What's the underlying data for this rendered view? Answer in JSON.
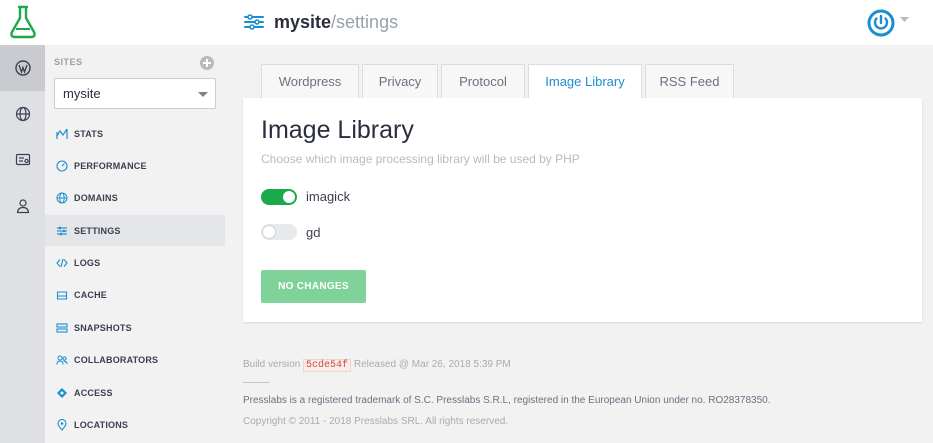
{
  "header": {
    "site_name": "mysite",
    "path": "/settings"
  },
  "sidebar": {
    "sites_label": "SITES",
    "selected_site": "mysite",
    "items": [
      {
        "label": "STATS",
        "icon": "stats-icon"
      },
      {
        "label": "PERFORMANCE",
        "icon": "gauge-icon"
      },
      {
        "label": "DOMAINS",
        "icon": "globe-icon"
      },
      {
        "label": "SETTINGS",
        "icon": "sliders-icon",
        "active": true
      },
      {
        "label": "LOGS",
        "icon": "code-icon"
      },
      {
        "label": "CACHE",
        "icon": "cache-icon"
      },
      {
        "label": "SNAPSHOTS",
        "icon": "snapshots-icon"
      },
      {
        "label": "COLLABORATORS",
        "icon": "collaborators-icon"
      },
      {
        "label": "ACCESS",
        "icon": "key-icon"
      },
      {
        "label": "LOCATIONS",
        "icon": "map-pin-icon"
      }
    ]
  },
  "tabs": [
    {
      "label": "Wordpress"
    },
    {
      "label": "Privacy"
    },
    {
      "label": "Protocol"
    },
    {
      "label": "Image Library",
      "active": true
    },
    {
      "label": "RSS Feed"
    }
  ],
  "panel": {
    "title": "Image Library",
    "description": "Choose which image processing library will be used by PHP",
    "options": [
      {
        "label": "imagick",
        "enabled": true
      },
      {
        "label": "gd",
        "enabled": false
      }
    ],
    "button_label": "NO CHANGES"
  },
  "footer": {
    "build_prefix": "Build version",
    "build_hash": "5cde54f",
    "released": "Released @ Mar 26, 2018 5:39 PM",
    "trademark": "Presslabs is a registered trademark of S.C. Presslabs S.R.L, registered in the European Union under no. RO28378350.",
    "copyright": "Copyright © 2011 - 2018 Presslabs SRL. All rights reserved."
  },
  "colors": {
    "accent": "#1a8fd0",
    "brand_green": "#1ba94c",
    "button_disabled": "#7fd39a"
  }
}
